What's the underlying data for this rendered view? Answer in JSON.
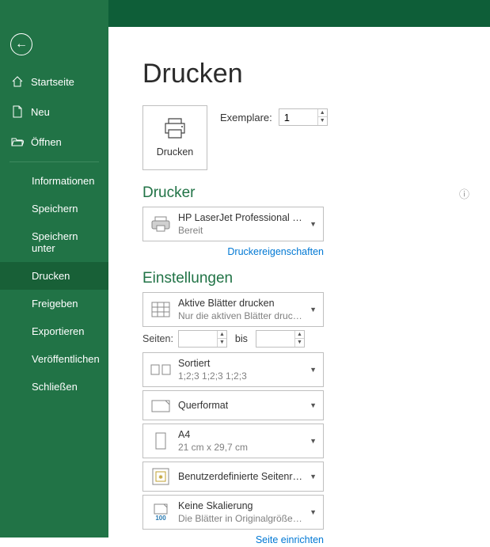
{
  "sidebar": {
    "items": [
      {
        "label": "Startseite"
      },
      {
        "label": "Neu"
      },
      {
        "label": "Öffnen"
      },
      {
        "label": "Informationen"
      },
      {
        "label": "Speichern"
      },
      {
        "label": "Speichern unter"
      },
      {
        "label": "Drucken"
      },
      {
        "label": "Freigeben"
      },
      {
        "label": "Exportieren"
      },
      {
        "label": "Veröffentlichen"
      },
      {
        "label": "Schließen"
      }
    ]
  },
  "main": {
    "title": "Drucken",
    "print_button": "Drucken",
    "copies_label": "Exemplare:",
    "copies_value": "1",
    "printer_heading": "Drucker",
    "printer": {
      "name": "HP LaserJet Professional C…",
      "status": "Bereit"
    },
    "printer_props": "Druckereigenschaften",
    "settings_heading": "Einstellungen",
    "setting_print_area": {
      "title": "Aktive Blätter drucken",
      "sub": "Nur die aktiven Blätter druc…"
    },
    "pages_label": "Seiten:",
    "pages_from": "",
    "pages_to_label": "bis",
    "pages_to": "",
    "setting_collation": {
      "title": "Sortiert",
      "sub": "1;2;3    1;2;3    1;2;3"
    },
    "setting_orientation": {
      "title": "Querformat"
    },
    "setting_paper": {
      "title": "A4",
      "sub": "21 cm x 29,7 cm"
    },
    "setting_margins": {
      "title": "Benutzerdefinierte Seitenrän…"
    },
    "setting_scaling": {
      "title": "Keine Skalierung",
      "sub": "Die Blätter in Originalgröße…",
      "badge": "100"
    },
    "page_setup": "Seite einrichten"
  }
}
